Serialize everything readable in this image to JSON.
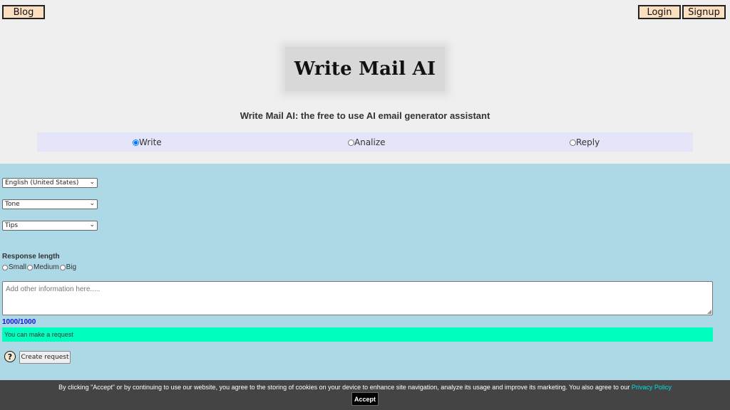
{
  "header": {
    "blog_label": "Blog",
    "login_label": "Login",
    "signup_label": "Signup"
  },
  "logo": {
    "text": "Write Mail AI"
  },
  "subtitle": "Write Mail AI: the free to use AI email generator assistant",
  "modes": {
    "selected": "Write",
    "items": [
      {
        "label": "Write",
        "checked": true
      },
      {
        "label": "Analize",
        "checked": false
      },
      {
        "label": "Reply",
        "checked": false
      }
    ]
  },
  "form": {
    "language_select": {
      "value": "English (United States)"
    },
    "tone_select": {
      "value": "Tone"
    },
    "tips_select": {
      "value": "Tips"
    },
    "response_length": {
      "label": "Response length",
      "options": [
        "Small",
        "Medium",
        "Big"
      ]
    },
    "info_textarea": {
      "placeholder": "Add other information here....."
    },
    "char_counter": "1000/1000",
    "status_message": "You can make a request",
    "help_icon": "question-mark-icon",
    "create_button_label": "Create request"
  },
  "cookie_banner": {
    "text": "By clicking \"Accept\" or by continuing to use our website, you agree to the storing of cookies on your device to enhance site navigation, analyze its usage and improve its marketing. You also agree to our ",
    "link_label": "Privacy Policy",
    "accept_label": "Accept"
  },
  "colors": {
    "page_bg": "#efefef",
    "main_bg": "#add8e6",
    "mode_bar_bg": "#e5e5fa",
    "status_bg": "#00ffbf",
    "top_button_bg": "#fbdfc0",
    "counter_color": "#1414e0",
    "cookie_bg": "#444444",
    "link_color": "#00e0e0"
  }
}
